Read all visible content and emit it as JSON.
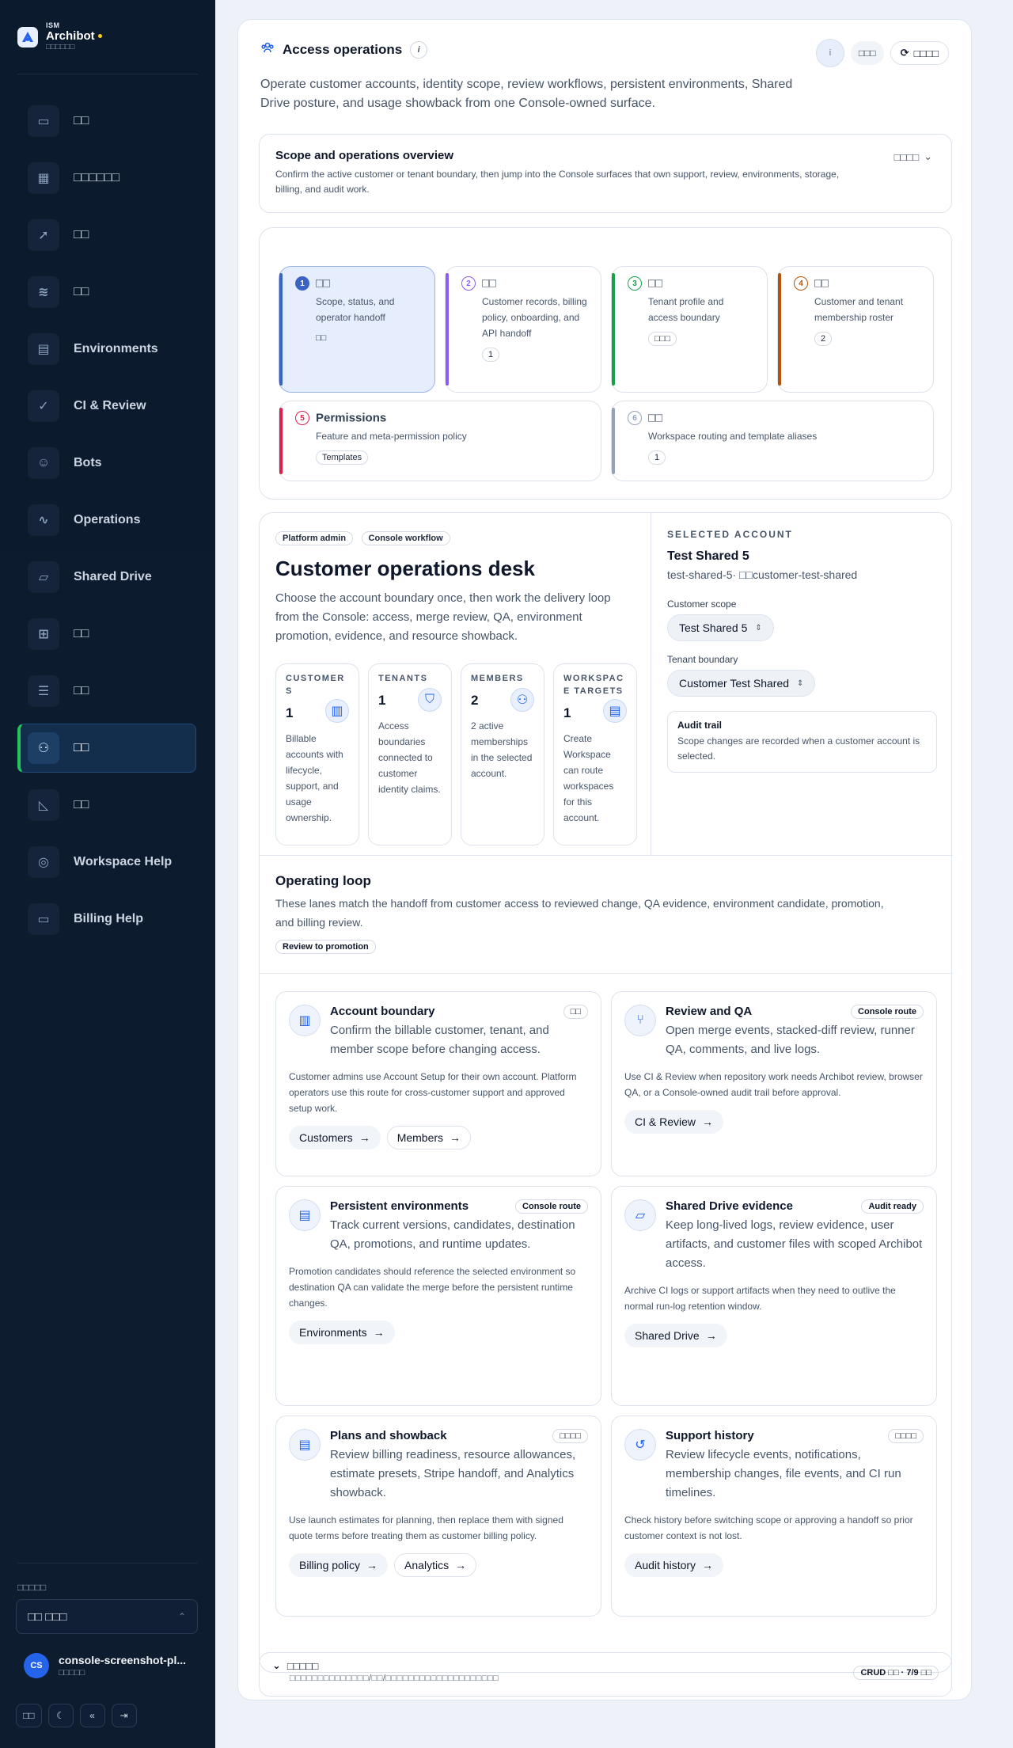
{
  "brand": {
    "small": "ISM",
    "name": "Archibot",
    "sub": "□□□□□□"
  },
  "nav": [
    {
      "label": "□□",
      "icon": "chat-icon"
    },
    {
      "label": "□□□□□□",
      "icon": "dashboard-icon"
    },
    {
      "label": "□□",
      "icon": "rocket-icon"
    },
    {
      "label": "□□",
      "icon": "database-icon"
    },
    {
      "label": "Environments",
      "icon": "server-icon"
    },
    {
      "label": "CI & Review",
      "icon": "check-circle-icon"
    },
    {
      "label": "Bots",
      "icon": "bot-icon"
    },
    {
      "label": "Operations",
      "icon": "pulse-icon"
    },
    {
      "label": "Shared Drive",
      "icon": "folder-icon"
    },
    {
      "label": "□□",
      "icon": "cart-icon"
    },
    {
      "label": "□□",
      "icon": "sliders-icon"
    },
    {
      "label": "□□",
      "icon": "users-icon"
    },
    {
      "label": "□□",
      "icon": "chart-icon"
    },
    {
      "label": "Workspace Help",
      "icon": "help-icon"
    },
    {
      "label": "Billing Help",
      "icon": "card-icon"
    }
  ],
  "active_nav_index": 11,
  "workspace": {
    "label": "□□□□□",
    "value": "□□ □□□"
  },
  "user": {
    "initials": "CS",
    "name": "console-screenshot-pl...",
    "role": "□□□□□"
  },
  "side_actions": [
    "□□",
    "☾",
    "«",
    "⇥"
  ],
  "header": {
    "title": "Access operations",
    "info": "i",
    "btn_small": "i",
    "btn_ghost": "□□□",
    "btn_refresh": "□□□□",
    "description": "Operate customer accounts, identity scope, review workflows, persistent environments, Shared Drive posture, and usage showback from one Console-owned surface."
  },
  "overview": {
    "title": "Scope and operations overview",
    "description": "Confirm the active customer or tenant boundary, then jump into the Console surfaces that own support, review, environments, storage, billing, and audit work.",
    "toggle": "□□□□"
  },
  "steps": [
    {
      "num": "1",
      "title": "□□",
      "desc": "Scope, status, and operator handoff",
      "badge": "□□",
      "color": "#3b63c4"
    },
    {
      "num": "2",
      "title": "□□",
      "desc": "Customer records, billing policy, onboarding, and API handoff",
      "badge": "1",
      "color": "#8b5cf6"
    },
    {
      "num": "3",
      "title": "□□",
      "desc": "Tenant profile and access boundary",
      "badge": "□□□",
      "color": "#16a34a"
    },
    {
      "num": "4",
      "title": "□□",
      "desc": "Customer and tenant membership roster",
      "badge": "2",
      "color": "#b45309"
    },
    {
      "num": "5",
      "title": "Permissions",
      "desc": "Feature and meta-permission policy",
      "badge": "Templates",
      "color": "#e11d48"
    },
    {
      "num": "6",
      "title": "□□",
      "desc": "Workspace routing and template aliases",
      "badge": "1",
      "color": "#94a3b8"
    }
  ],
  "desk": {
    "tags": [
      "Platform admin",
      "Console workflow"
    ],
    "title": "Customer operations desk",
    "description": "Choose the account boundary once, then work the delivery loop from the Console: access, merge review, QA, environment promotion, evidence, and resource showback.",
    "metrics": [
      {
        "label": "CUSTOMER S",
        "value": "1",
        "icon": "building-icon",
        "desc": "Billable accounts with lifecycle, support, and usage ownership."
      },
      {
        "label": "TENANTS",
        "value": "1",
        "icon": "shield-icon",
        "desc": "Access boundaries connected to customer identity claims."
      },
      {
        "label": "MEMBERS",
        "value": "2",
        "icon": "users-icon",
        "desc": "2 active memberships in the selected account."
      },
      {
        "label": "WORKSPAC E TARGETS",
        "value": "1",
        "icon": "server-icon",
        "desc": "Create Workspace can route workspaces for this account."
      }
    ]
  },
  "selected": {
    "label": "SELECTED ACCOUNT",
    "name": "Test Shared 5",
    "sub": "test-shared-5· □□customer-test-shared",
    "scope_label": "Customer scope",
    "scope_value": "Test Shared 5",
    "tenant_label": "Tenant boundary",
    "tenant_value": "Customer Test Shared",
    "audit_title": "Audit trail",
    "audit_desc": "Scope changes are recorded when a customer account is selected."
  },
  "loop": {
    "title": "Operating loop",
    "description": "These lanes match the handoff from customer access to reviewed change, QA evidence, environment candidate, promotion, and billing review.",
    "tag": "Review to promotion"
  },
  "cards": [
    {
      "title": "Account boundary",
      "icon": "building-icon",
      "badge": "□□",
      "sub": "Confirm the billable customer, tenant, and member scope before changing access.",
      "note": "Customer admins use Account Setup for their own account. Platform operators use this route for cross-customer support and approved setup work.",
      "links": [
        "Customers",
        "Members"
      ]
    },
    {
      "title": "Review and QA",
      "icon": "merge-icon",
      "badge": "Console route",
      "sub": "Open merge events, stacked-diff review, runner QA, comments, and live logs.",
      "note": "Use CI & Review when repository work needs Archibot review, browser QA, or a Console-owned audit trail before approval.",
      "links": [
        "CI & Review"
      ]
    },
    {
      "title": "Persistent environments",
      "icon": "server-icon",
      "badge": "Console route",
      "sub": "Track current versions, candidates, destination QA, promotions, and runtime updates.",
      "note": "Promotion candidates should reference the selected environment so destination QA can validate the merge before the persistent runtime changes.",
      "links": [
        "Environments"
      ]
    },
    {
      "title": "Shared Drive evidence",
      "icon": "folder-icon",
      "badge": "Audit ready",
      "sub": "Keep long-lived logs, review evidence, user artifacts, and customer files with scoped Archibot access.",
      "note": "Archive CI logs or support artifacts when they need to outlive the normal run-log retention window.",
      "links": [
        "Shared Drive"
      ]
    },
    {
      "title": "Plans and showback",
      "icon": "receipt-icon",
      "badge": "□□□□",
      "sub": "Review billing readiness, resource allowances, estimate presets, Stripe handoff, and Analytics showback.",
      "note": "Use launch estimates for planning, then replace them with signed quote terms before treating them as customer billing policy.",
      "links": [
        "Billing policy",
        "Analytics"
      ]
    },
    {
      "title": "Support history",
      "icon": "history-icon",
      "badge": "□□□□",
      "sub": "Review lifecycle events, notifications, membership changes, file events, and CI run timelines.",
      "note": "Check history before switching scope or approving a handoff so prior customer context is not lost.",
      "links": [
        "Audit history"
      ]
    }
  ],
  "footer": {
    "title": "□□□□□",
    "sub": "□□□□□□□□□□□□□□/□□/□□□□□□□□□□□□□□□□□□□□",
    "badge": "CRUD □□ · 7/9 □□"
  },
  "colors": {
    "sidebar": "#0c1a2d",
    "accent": "#2563eb",
    "active_bar": "#22c55e"
  }
}
